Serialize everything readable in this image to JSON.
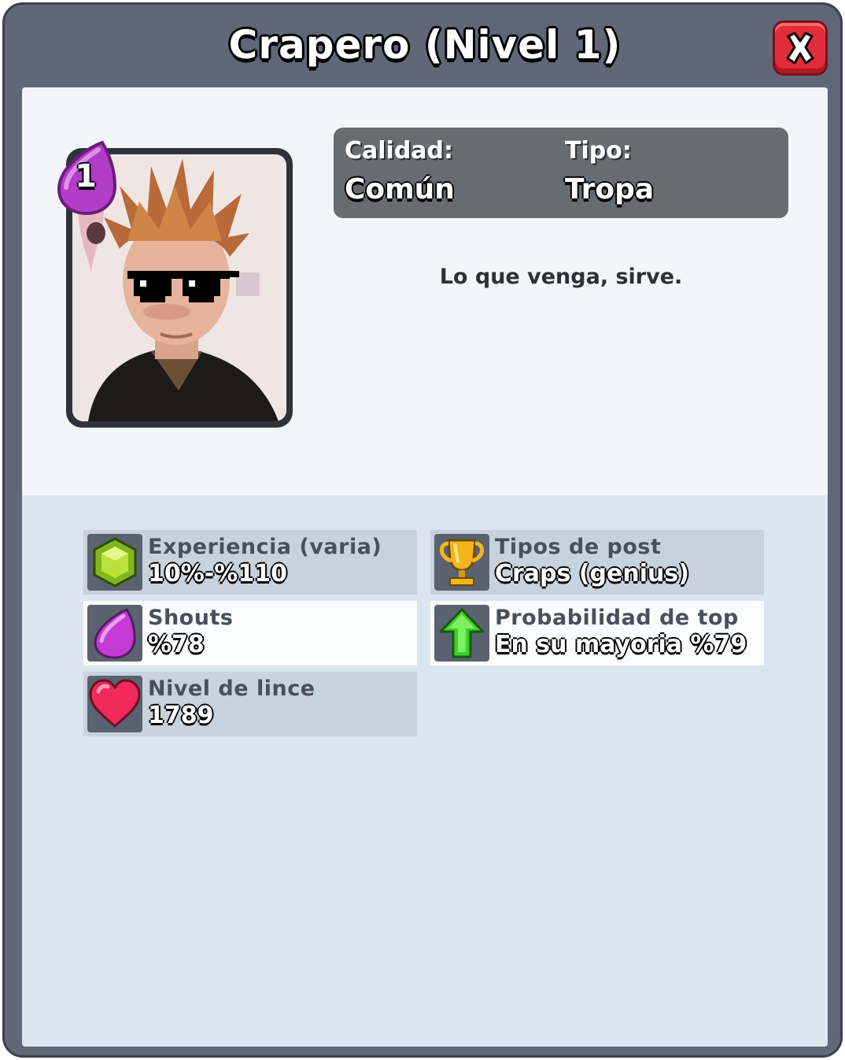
{
  "header": {
    "title": "Crapero (Nivel 1)"
  },
  "card": {
    "level": "1"
  },
  "info": {
    "quality_label": "Calidad:",
    "quality_value": "Común",
    "type_label": "Tipo:",
    "type_value": "Tropa"
  },
  "description": "Lo que venga, sirve.",
  "stats": [
    {
      "name": "Experiencia (varia)",
      "value": "10%-%110",
      "icon": "gem-icon"
    },
    {
      "name": "Tipos de post",
      "value": "Craps (genius)",
      "icon": "trophy-icon"
    },
    {
      "name": "Shouts",
      "value": "%78",
      "icon": "elixir-icon"
    },
    {
      "name": "Probabilidad de top",
      "value": "En su mayoria %79",
      "icon": "arrow-up-icon"
    },
    {
      "name": "Nivel de lince",
      "value": "1789",
      "icon": "heart-icon"
    }
  ],
  "colors": {
    "frame": "#5f6778",
    "close_button": "#e12d37",
    "panel": "#dce5ed",
    "level_drop": "#b23ec8"
  }
}
